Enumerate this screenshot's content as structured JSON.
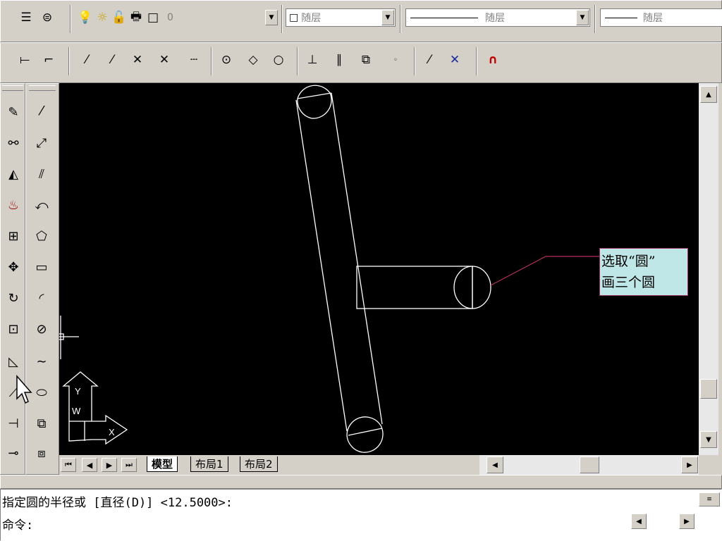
{
  "toolbar_top": {
    "layer_combo_value": "0",
    "color_combo_value": "随层",
    "linetype_combo_value": "随层",
    "lineweight_combo_value": "随层"
  },
  "tabs": [
    {
      "label": "模型",
      "active": true
    },
    {
      "label": "布局1",
      "active": false
    },
    {
      "label": "布局2",
      "active": false
    }
  ],
  "ucs_icon": {
    "y_label": "Y",
    "w_label": "W",
    "x_label": "X"
  },
  "callout": {
    "text": "选取“圆”\n画三个圆"
  },
  "command": {
    "prompt_line": "指定圆的半径或 [直径(D)] <12.5000>:",
    "input_line": "命令:"
  },
  "icons": {
    "colors": {
      "canvas": "#000000",
      "drawing": "#ffffff",
      "callout_bg": "#bfe7e7",
      "leader": "#b03060",
      "chrome": "#d4d0c8"
    }
  }
}
